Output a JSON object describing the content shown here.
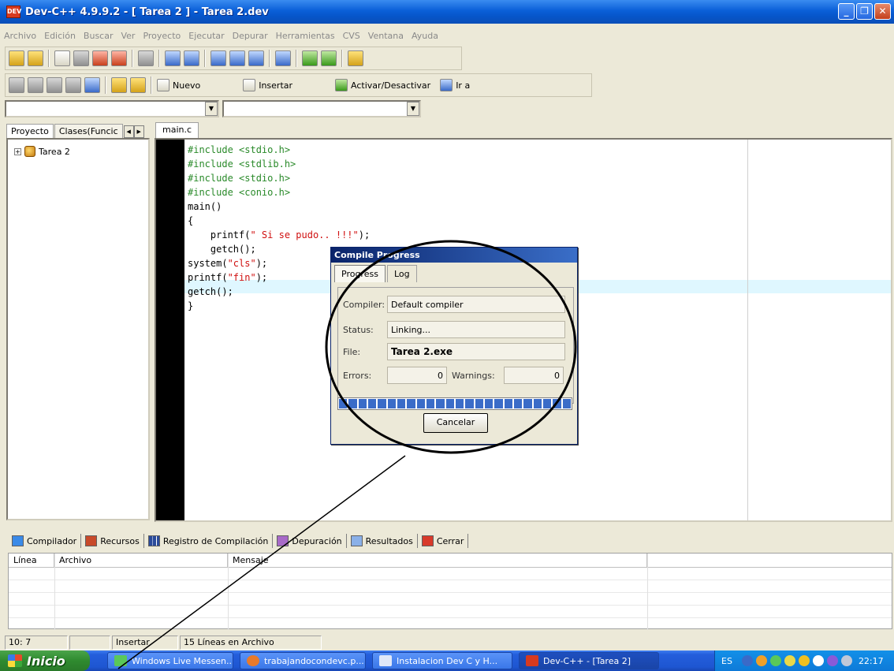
{
  "window": {
    "title": "Dev-C++ 4.9.9.2  - [ Tarea 2 ] - Tarea 2.dev",
    "app_icon_text": "DEV"
  },
  "menu": [
    "Archivo",
    "Edición",
    "Buscar",
    "Ver",
    "Proyecto",
    "Ejecutar",
    "Depurar",
    "Herramientas",
    "CVS",
    "Ventana",
    "Ayuda"
  ],
  "toolbar2": {
    "nuevo": "Nuevo",
    "insertar": "Insertar",
    "activar": "Activar/Desactivar",
    "ir_a": "Ir a"
  },
  "left_tabs": [
    "Proyecto",
    "Clases(Funcic"
  ],
  "project_tree": {
    "root": "Tarea 2"
  },
  "editor": {
    "tab": "main.c",
    "lines": [
      "#include <stdio.h>",
      "#include <stdlib.h>",
      "#include <stdio.h>",
      "#include <conio.h>",
      "main()",
      "{",
      "    printf(\" Si se pudo.. !!!\");",
      "    getch();",
      "system(\"cls\");",
      "printf(\"fin\");",
      "getch();",
      "}"
    ]
  },
  "compile_dialog": {
    "title": "Compile Progress",
    "tabs": [
      "Progress",
      "Log"
    ],
    "compiler_label": "Compiler:",
    "compiler_value": "Default compiler",
    "status_label": "Status:",
    "status_value": "Linking...",
    "file_label": "File:",
    "file_value": "Tarea 2.exe",
    "errors_label": "Errors:",
    "errors_value": "0",
    "warnings_label": "Warnings:",
    "warnings_value": "0",
    "progress": 1.0,
    "cancel_button": "Cancelar"
  },
  "bottom_tabs": [
    "Compilador",
    "Recursos",
    "Registro de Compilación",
    "Depuración",
    "Resultados",
    "Cerrar"
  ],
  "messages_table": {
    "columns": [
      "Línea",
      "Archivo",
      "Mensaje"
    ]
  },
  "status_bar": {
    "position": "10: 7",
    "mode": "Insertar",
    "lines": "15 Líneas en Archivo"
  },
  "taskbar": {
    "start": "Inicio",
    "tasks": [
      "Windows Live Messen...",
      "trabajandocondevc.p...",
      "Instalacion Dev C y H...",
      "Dev-C++ - [Tarea 2]"
    ],
    "lang": "ES",
    "clock": "22:17"
  },
  "colors": {
    "title_blue": "#0a5fd8",
    "progress_blue": "#3a6cc8",
    "annotation": "#000000"
  }
}
